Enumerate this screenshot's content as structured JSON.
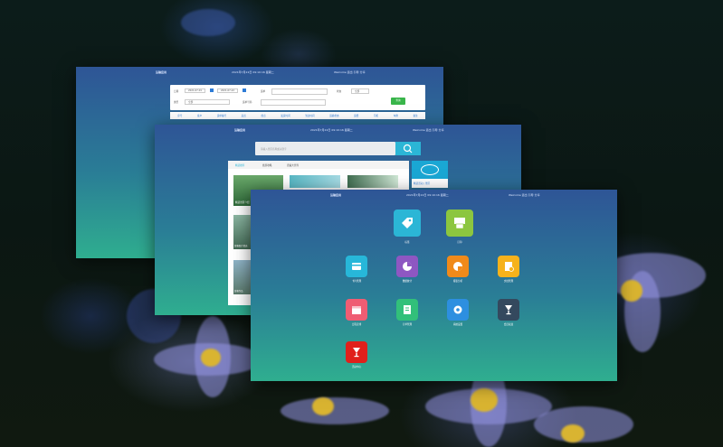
{
  "window1": {
    "title": "运输应用",
    "datetime": "2021年7月22日 09:10:16 星期二",
    "user": "Welcome  退出  引导  分享",
    "form": {
      "date_label": "日期",
      "date_from": "2021-07-01",
      "date_to": "2021-07-22",
      "field_label": "运单",
      "status_label": "状态",
      "status_value": "全部",
      "search_btn": "查询",
      "type_label": "类型",
      "type_value": "全部",
      "code_label": "运单号码"
    },
    "columns": [
      "序号",
      "客户",
      "运单编号",
      "起点",
      "终点",
      "发货时间",
      "到达时间",
      "运输状态",
      "运费",
      "司机",
      "车牌",
      "备注"
    ]
  },
  "window2": {
    "title": "运输应用",
    "datetime": "2021年7月22日 09:10:16 星期二",
    "user": "Welcome  退出  引导  分享",
    "search_placeholder": "请输入景区名称或关键字",
    "tabs": [
      "精选推荐",
      "旅游攻略",
      "游遍大世界"
    ],
    "card_labels": [
      "精选景区介绍",
      "游客照片精选",
      "美丽风光",
      "游客作品"
    ],
    "promo_text": "精选活动 | 景区"
  },
  "window3": {
    "title": "运输应用",
    "datetime": "2021年7月22日 09:10:16 星期二",
    "user": "Welcome  退出  引导  分享",
    "apps": [
      {
        "label": "标签",
        "icon": "tag-icon",
        "color": "#2bb6d6"
      },
      {
        "label": "打印",
        "icon": "printer-icon",
        "color": "#8cc63f"
      },
      {
        "label": "卡片管理",
        "icon": "card-icon",
        "color": "#27b7d9"
      },
      {
        "label": "数据统计",
        "icon": "pie-chart-icon",
        "color": "#8e57c2"
      },
      {
        "label": "报表分析",
        "icon": "pie-chart-icon",
        "color": "#f08a1a"
      },
      {
        "label": "文档管理",
        "icon": "document-icon",
        "color": "#f6b21b"
      },
      {
        "label": "日程安排",
        "icon": "calendar-icon",
        "color": "#ef5d73"
      },
      {
        "label": "订单管理",
        "icon": "clipboard-icon",
        "color": "#32c07a"
      },
      {
        "label": "系统设置",
        "icon": "gear-icon",
        "color": "#2d8fe0"
      },
      {
        "label": "会员权益",
        "icon": "trophy-icon",
        "color": "#34495e"
      },
      {
        "label": "活动中心",
        "icon": "cup-icon",
        "color": "#e0201b"
      }
    ]
  }
}
